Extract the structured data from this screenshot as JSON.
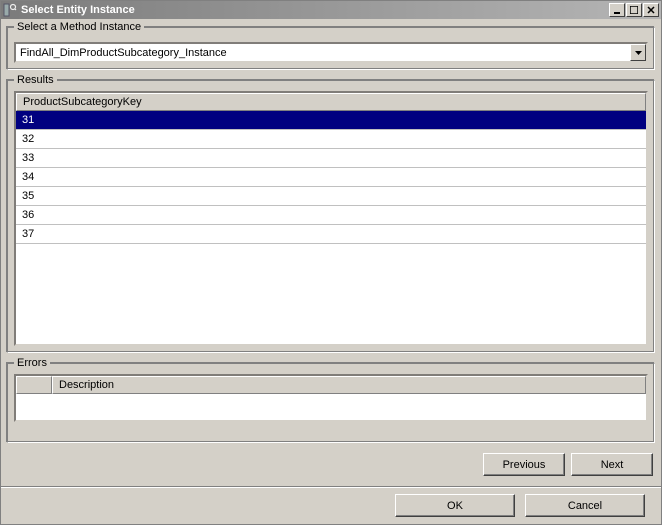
{
  "window": {
    "title": "Select Entity Instance"
  },
  "method_group": {
    "legend": "Select a Method Instance",
    "combo_value": "FindAll_DimProductSubcategory_Instance"
  },
  "results_group": {
    "legend": "Results",
    "column_header": "ProductSubcategoryKey",
    "rows": [
      "31",
      "32",
      "33",
      "34",
      "35",
      "36",
      "37"
    ],
    "selected_index": 0
  },
  "errors_group": {
    "legend": "Errors",
    "column_header": "Description"
  },
  "nav": {
    "previous": "Previous",
    "next": "Next"
  },
  "bottom": {
    "ok": "OK",
    "cancel": "Cancel"
  }
}
